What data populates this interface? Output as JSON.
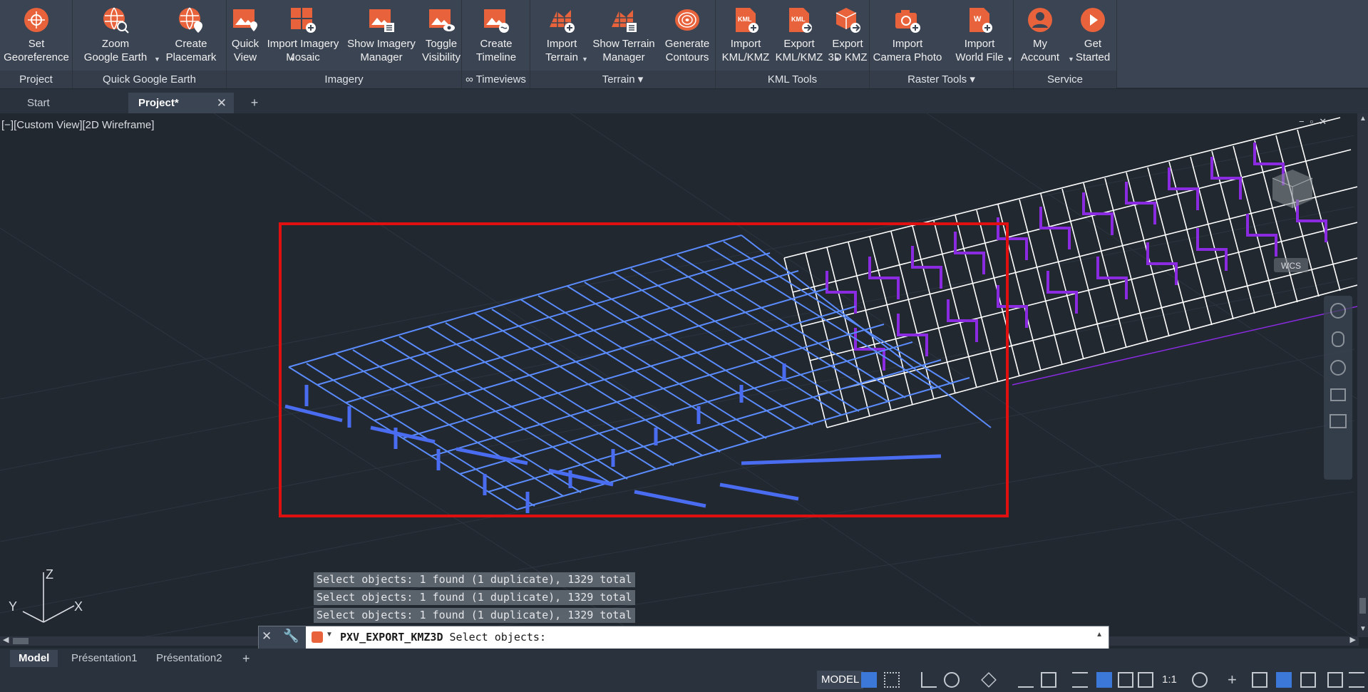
{
  "ribbon": {
    "panels": [
      {
        "label": "Project"
      },
      {
        "label": "Quick Google Earth"
      },
      {
        "label": "Imagery"
      },
      {
        "label": "∞ Timeviews"
      },
      {
        "label": "Terrain ▾"
      },
      {
        "label": "KML Tools"
      },
      {
        "label": "Raster Tools ▾"
      },
      {
        "label": "Service"
      }
    ],
    "buttons": {
      "set_georeference": "Set\nGeoreference",
      "zoom_google_earth": "Zoom\nGoogle Earth",
      "create_placemark": "Create\nPlacemark",
      "quick_view": "Quick\nView",
      "import_imagery_mosaic": "Import Imagery\nMosaic",
      "show_imagery_manager": "Show Imagery\nManager",
      "toggle_visibility": "Toggle\nVisibility",
      "create_timeline": "Create\nTimeline",
      "import_terrain": "Import\nTerrain",
      "show_terrain_manager": "Show Terrain\nManager",
      "generate_contours": "Generate\nContours",
      "import_kml_kmz": "Import\nKML/KMZ",
      "export_kml_kmz": "Export\nKML/KMZ",
      "export_3d_kmz": "Export\n3D KMZ",
      "import_camera_photo": "Import\nCamera Photo",
      "import_world_file": "Import\nWorld File",
      "my_account": "My\nAccount",
      "get_started": "Get\nStarted"
    }
  },
  "file_tabs": {
    "start": "Start",
    "project": "Project*"
  },
  "viewport": {
    "view_label": "[−][Custom View][2D Wireframe]",
    "axis_z": "Z",
    "axis_y": "Y",
    "axis_x": "X",
    "wcs_label": "WCS"
  },
  "command": {
    "history": [
      "Select objects: 1 found (1 duplicate), 1329 total",
      "Select objects: 1 found (1 duplicate), 1329 total",
      "Select objects: 1 found (1 duplicate), 1329 total"
    ],
    "name": "PXV_EXPORT_KMZ3D",
    "prompt": "Select objects:"
  },
  "layout_tabs": {
    "model": "Model",
    "layout1": "Présentation1",
    "layout2": "Présentation2"
  },
  "status": {
    "model": "MODEL",
    "scale": "1:1"
  },
  "colors": {
    "accent": "#e8633c",
    "selection_box": "#e01010",
    "selected": "#5b8cff",
    "purple": "#8a2be2"
  }
}
